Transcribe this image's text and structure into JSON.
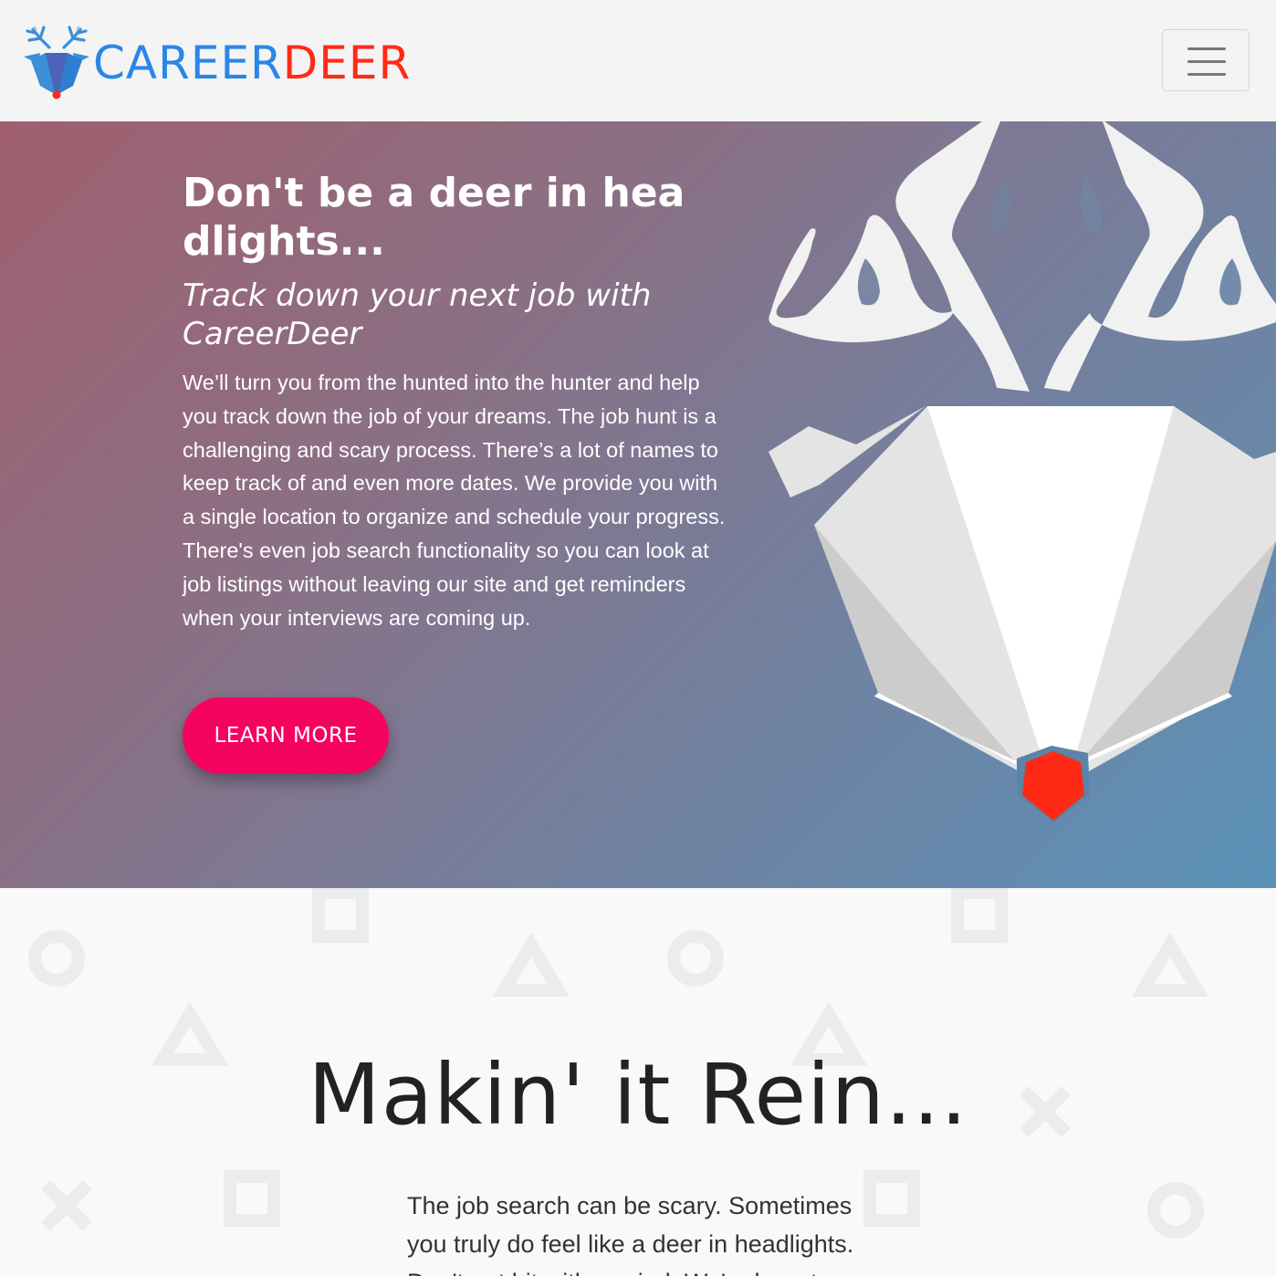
{
  "navbar": {
    "brand_part_1": "CAREER",
    "brand_part_2": "DEER",
    "logo_icon": "deer-head-logo-icon",
    "menu_icon": "hamburger-menu-icon"
  },
  "hero": {
    "title": "Don't be a deer in headlights...",
    "subtitle": "Track down your next job with CareerDeer",
    "text": "We’ll turn you from the hunted into the hunter and help you track down the job of your dreams. The job hunt is a challenging and scary process. There’s a lot of names to keep track of and even more dates. We provide you with a single location to organize and schedule your progress. There's even job search functionality so you can look at job listings without leaving our site and get reminders when your interviews are coming up.",
    "button_label": "LEARN MORE",
    "illustration_icon": "deer-head-illustration"
  },
  "section_two": {
    "title": "Makin' it Rein...",
    "text": "The job search can be scary. Sometimes you truly do feel like a deer in headlights. Don't get hit with a grind. We're here to"
  },
  "colors": {
    "brand_blue": "#2a86e8",
    "brand_red": "#ff2a16",
    "button_pink": "#f4045f",
    "hero_gradient_start": "#a05f6e",
    "hero_gradient_end": "#5b92b8"
  }
}
